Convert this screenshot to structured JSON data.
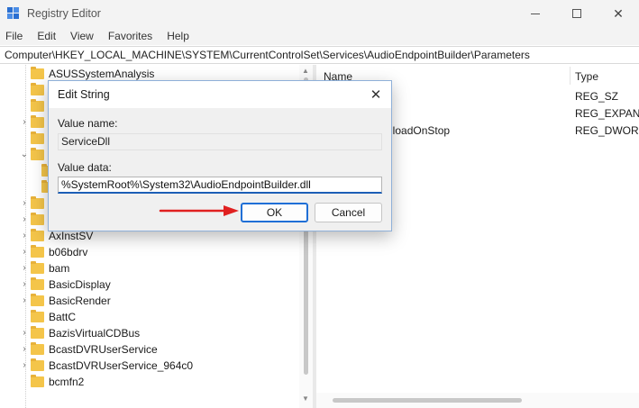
{
  "window": {
    "title": "Registry Editor",
    "controls": {
      "minimize": "minimize",
      "maximize": "maximize",
      "close": "✕"
    }
  },
  "menu": [
    "File",
    "Edit",
    "View",
    "Favorites",
    "Help"
  ],
  "address": "Computer\\HKEY_LOCAL_MACHINE\\SYSTEM\\CurrentControlSet\\Services\\AudioEndpointBuilder\\Parameters",
  "tree": {
    "items": [
      {
        "label": "ASUSSystemAnalysis",
        "expander": ""
      },
      {
        "label": "",
        "expander": ""
      },
      {
        "label": "",
        "expander": ""
      },
      {
        "label": "",
        "expander": "›"
      },
      {
        "label": "",
        "expander": ""
      },
      {
        "label": "",
        "expander": "⌄"
      },
      {
        "label": "",
        "expander": ""
      },
      {
        "label": "",
        "expander": ""
      },
      {
        "label": "",
        "expander": "›"
      },
      {
        "label": "",
        "expander": "›"
      },
      {
        "label": "AxInstSV",
        "expander": "›"
      },
      {
        "label": "b06bdrv",
        "expander": "›"
      },
      {
        "label": "bam",
        "expander": "›"
      },
      {
        "label": "BasicDisplay",
        "expander": "›"
      },
      {
        "label": "BasicRender",
        "expander": "›"
      },
      {
        "label": "BattC",
        "expander": ""
      },
      {
        "label": "BazisVirtualCDBus",
        "expander": "›"
      },
      {
        "label": "BcastDVRUserService",
        "expander": "›"
      },
      {
        "label": "BcastDVRUserService_964c0",
        "expander": "›"
      },
      {
        "label": "bcmfn2",
        "expander": ""
      }
    ]
  },
  "list": {
    "columns": {
      "name": "Name",
      "type": "Type"
    },
    "rows": [
      {
        "name": "",
        "type": "REG_SZ"
      },
      {
        "name": "",
        "type": "REG_EXPAND"
      },
      {
        "name": "nloadOnStop",
        "type": "REG_DWORD"
      }
    ]
  },
  "dialog": {
    "title": "Edit String",
    "close": "✕",
    "value_name_label": "Value name:",
    "value_name": "ServiceDll",
    "value_data_label": "Value data:",
    "value_data": "%SystemRoot%\\System32\\AudioEndpointBuilder.dll",
    "ok_label": "OK",
    "cancel_label": "Cancel"
  },
  "colors": {
    "accent": "#1f6fd6",
    "folder": "#f4c54a",
    "annotation_arrow": "#e02020"
  }
}
